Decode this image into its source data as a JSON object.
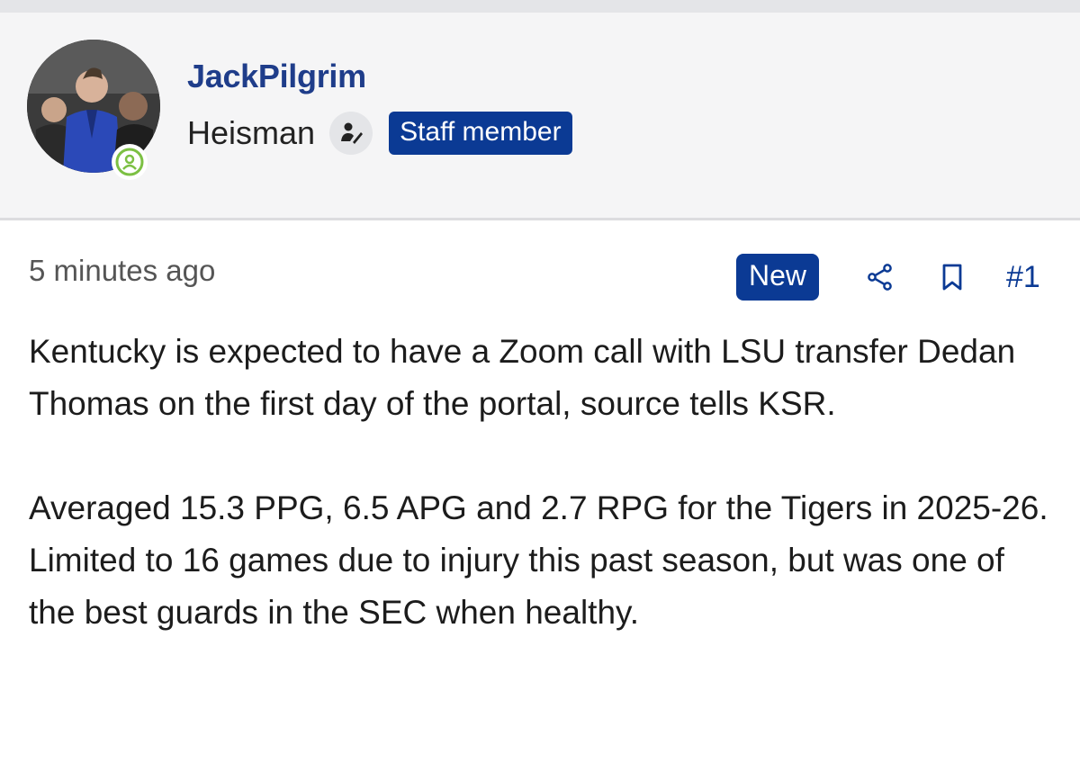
{
  "header": {
    "username": "JackPilgrim",
    "user_title": "Heisman",
    "staff_badge": "Staff member",
    "avatar_icon": "user-avatar-photo",
    "status_icon": "online-status-icon",
    "rank_icon": "user-rank-icon"
  },
  "post": {
    "time_ago": "5 minutes ago",
    "new_badge": "New",
    "post_number": "#1",
    "paragraphs": [
      "Kentucky is expected to have a Zoom call with LSU transfer Dedan Thomas on the first day of the portal, source tells KSR.",
      "Averaged 15.3 PPG, 6.5 APG and 2.7 RPG for the Tigers in 2025-26. Limited to 16 games due to injury this past season, but was one of the best guards in the SEC when healthy."
    ]
  },
  "colors": {
    "accent_blue": "#0b3a94",
    "username_blue": "#1f3d8a",
    "status_green": "#7cc043",
    "header_bg": "#f5f5f6"
  }
}
